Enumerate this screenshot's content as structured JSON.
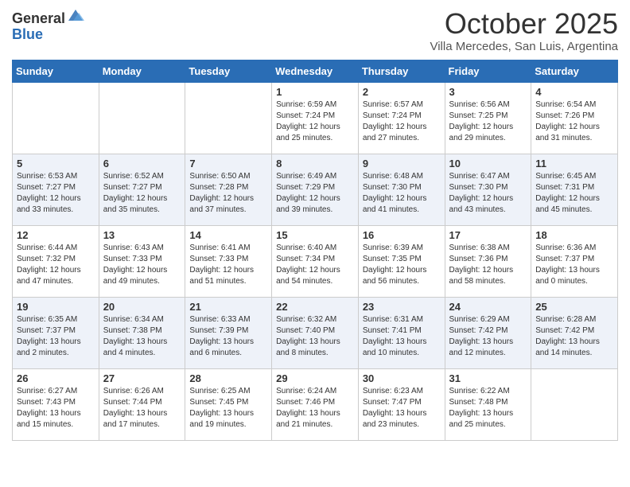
{
  "header": {
    "logo_general": "General",
    "logo_blue": "Blue",
    "month": "October 2025",
    "location": "Villa Mercedes, San Luis, Argentina"
  },
  "days_of_week": [
    "Sunday",
    "Monday",
    "Tuesday",
    "Wednesday",
    "Thursday",
    "Friday",
    "Saturday"
  ],
  "weeks": [
    [
      {
        "num": "",
        "info": ""
      },
      {
        "num": "",
        "info": ""
      },
      {
        "num": "",
        "info": ""
      },
      {
        "num": "1",
        "info": "Sunrise: 6:59 AM\nSunset: 7:24 PM\nDaylight: 12 hours\nand 25 minutes."
      },
      {
        "num": "2",
        "info": "Sunrise: 6:57 AM\nSunset: 7:24 PM\nDaylight: 12 hours\nand 27 minutes."
      },
      {
        "num": "3",
        "info": "Sunrise: 6:56 AM\nSunset: 7:25 PM\nDaylight: 12 hours\nand 29 minutes."
      },
      {
        "num": "4",
        "info": "Sunrise: 6:54 AM\nSunset: 7:26 PM\nDaylight: 12 hours\nand 31 minutes."
      }
    ],
    [
      {
        "num": "5",
        "info": "Sunrise: 6:53 AM\nSunset: 7:27 PM\nDaylight: 12 hours\nand 33 minutes."
      },
      {
        "num": "6",
        "info": "Sunrise: 6:52 AM\nSunset: 7:27 PM\nDaylight: 12 hours\nand 35 minutes."
      },
      {
        "num": "7",
        "info": "Sunrise: 6:50 AM\nSunset: 7:28 PM\nDaylight: 12 hours\nand 37 minutes."
      },
      {
        "num": "8",
        "info": "Sunrise: 6:49 AM\nSunset: 7:29 PM\nDaylight: 12 hours\nand 39 minutes."
      },
      {
        "num": "9",
        "info": "Sunrise: 6:48 AM\nSunset: 7:30 PM\nDaylight: 12 hours\nand 41 minutes."
      },
      {
        "num": "10",
        "info": "Sunrise: 6:47 AM\nSunset: 7:30 PM\nDaylight: 12 hours\nand 43 minutes."
      },
      {
        "num": "11",
        "info": "Sunrise: 6:45 AM\nSunset: 7:31 PM\nDaylight: 12 hours\nand 45 minutes."
      }
    ],
    [
      {
        "num": "12",
        "info": "Sunrise: 6:44 AM\nSunset: 7:32 PM\nDaylight: 12 hours\nand 47 minutes."
      },
      {
        "num": "13",
        "info": "Sunrise: 6:43 AM\nSunset: 7:33 PM\nDaylight: 12 hours\nand 49 minutes."
      },
      {
        "num": "14",
        "info": "Sunrise: 6:41 AM\nSunset: 7:33 PM\nDaylight: 12 hours\nand 51 minutes."
      },
      {
        "num": "15",
        "info": "Sunrise: 6:40 AM\nSunset: 7:34 PM\nDaylight: 12 hours\nand 54 minutes."
      },
      {
        "num": "16",
        "info": "Sunrise: 6:39 AM\nSunset: 7:35 PM\nDaylight: 12 hours\nand 56 minutes."
      },
      {
        "num": "17",
        "info": "Sunrise: 6:38 AM\nSunset: 7:36 PM\nDaylight: 12 hours\nand 58 minutes."
      },
      {
        "num": "18",
        "info": "Sunrise: 6:36 AM\nSunset: 7:37 PM\nDaylight: 13 hours\nand 0 minutes."
      }
    ],
    [
      {
        "num": "19",
        "info": "Sunrise: 6:35 AM\nSunset: 7:37 PM\nDaylight: 13 hours\nand 2 minutes."
      },
      {
        "num": "20",
        "info": "Sunrise: 6:34 AM\nSunset: 7:38 PM\nDaylight: 13 hours\nand 4 minutes."
      },
      {
        "num": "21",
        "info": "Sunrise: 6:33 AM\nSunset: 7:39 PM\nDaylight: 13 hours\nand 6 minutes."
      },
      {
        "num": "22",
        "info": "Sunrise: 6:32 AM\nSunset: 7:40 PM\nDaylight: 13 hours\nand 8 minutes."
      },
      {
        "num": "23",
        "info": "Sunrise: 6:31 AM\nSunset: 7:41 PM\nDaylight: 13 hours\nand 10 minutes."
      },
      {
        "num": "24",
        "info": "Sunrise: 6:29 AM\nSunset: 7:42 PM\nDaylight: 13 hours\nand 12 minutes."
      },
      {
        "num": "25",
        "info": "Sunrise: 6:28 AM\nSunset: 7:42 PM\nDaylight: 13 hours\nand 14 minutes."
      }
    ],
    [
      {
        "num": "26",
        "info": "Sunrise: 6:27 AM\nSunset: 7:43 PM\nDaylight: 13 hours\nand 15 minutes."
      },
      {
        "num": "27",
        "info": "Sunrise: 6:26 AM\nSunset: 7:44 PM\nDaylight: 13 hours\nand 17 minutes."
      },
      {
        "num": "28",
        "info": "Sunrise: 6:25 AM\nSunset: 7:45 PM\nDaylight: 13 hours\nand 19 minutes."
      },
      {
        "num": "29",
        "info": "Sunrise: 6:24 AM\nSunset: 7:46 PM\nDaylight: 13 hours\nand 21 minutes."
      },
      {
        "num": "30",
        "info": "Sunrise: 6:23 AM\nSunset: 7:47 PM\nDaylight: 13 hours\nand 23 minutes."
      },
      {
        "num": "31",
        "info": "Sunrise: 6:22 AM\nSunset: 7:48 PM\nDaylight: 13 hours\nand 25 minutes."
      },
      {
        "num": "",
        "info": ""
      }
    ]
  ]
}
